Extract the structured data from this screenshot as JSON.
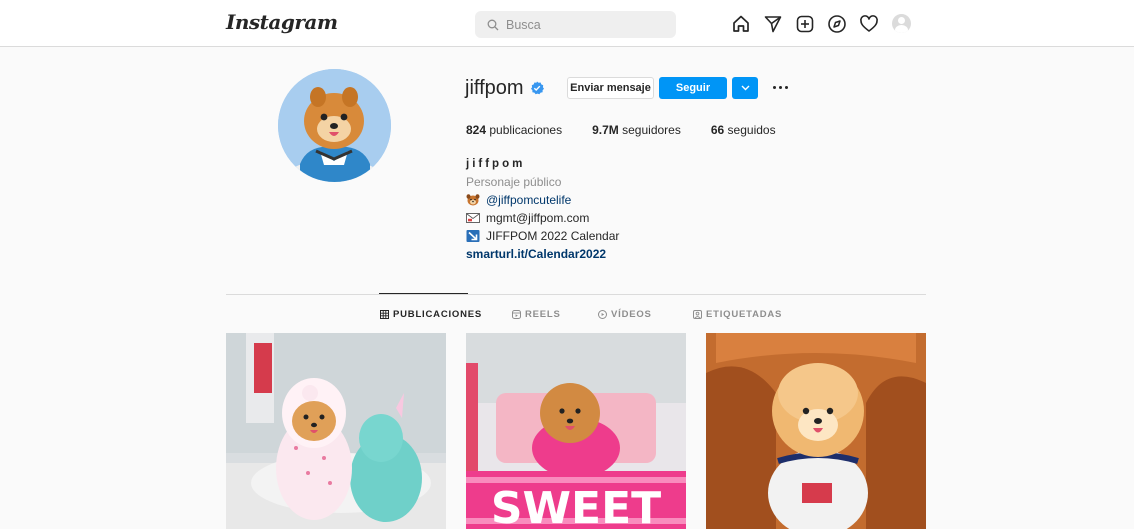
{
  "nav": {
    "logo": "Instagram",
    "search_placeholder": "Busca",
    "icons": [
      "home-icon",
      "direct-icon",
      "new-post-icon",
      "explore-icon",
      "activity-icon",
      "profile-avatar"
    ]
  },
  "profile": {
    "username": "jiffpom",
    "verified": true,
    "buttons": {
      "message": "Enviar mensaje",
      "follow": "Seguir"
    },
    "stats": {
      "posts_count": "824",
      "posts_label": "publicaciones",
      "followers_count": "9.7M",
      "followers_label": "seguidores",
      "following_count": "66",
      "following_label": "seguidos"
    },
    "bio": {
      "full_name": "jiffpom",
      "category": "Personaje público",
      "mention": "@jiffpomcutelife",
      "email": "mgmt@jiffpom.com",
      "calendar": "JIFFPOM 2022 Calendar",
      "link": "smarturl.it/Calendar2022"
    }
  },
  "tabs": [
    {
      "label": "PUBLICACIONES",
      "active": true,
      "icon": "grid-icon"
    },
    {
      "label": "REELS",
      "active": false,
      "icon": "reels-icon"
    },
    {
      "label": "VÍDEOS",
      "active": false,
      "icon": "video-icon"
    },
    {
      "label": "ETIQUETADAS",
      "active": false,
      "icon": "tagged-icon"
    }
  ],
  "posts": [
    {
      "description": "pomeranian in hoodie with unicorn plush"
    },
    {
      "description": "pomeranian in pink outfit",
      "overlay_text": "SWEET"
    },
    {
      "description": "pomeranian on leather chair"
    }
  ],
  "colors": {
    "accent": "#0095f6",
    "link": "#00376b",
    "border": "#dbdbdb",
    "muted": "#8e8e8e"
  }
}
